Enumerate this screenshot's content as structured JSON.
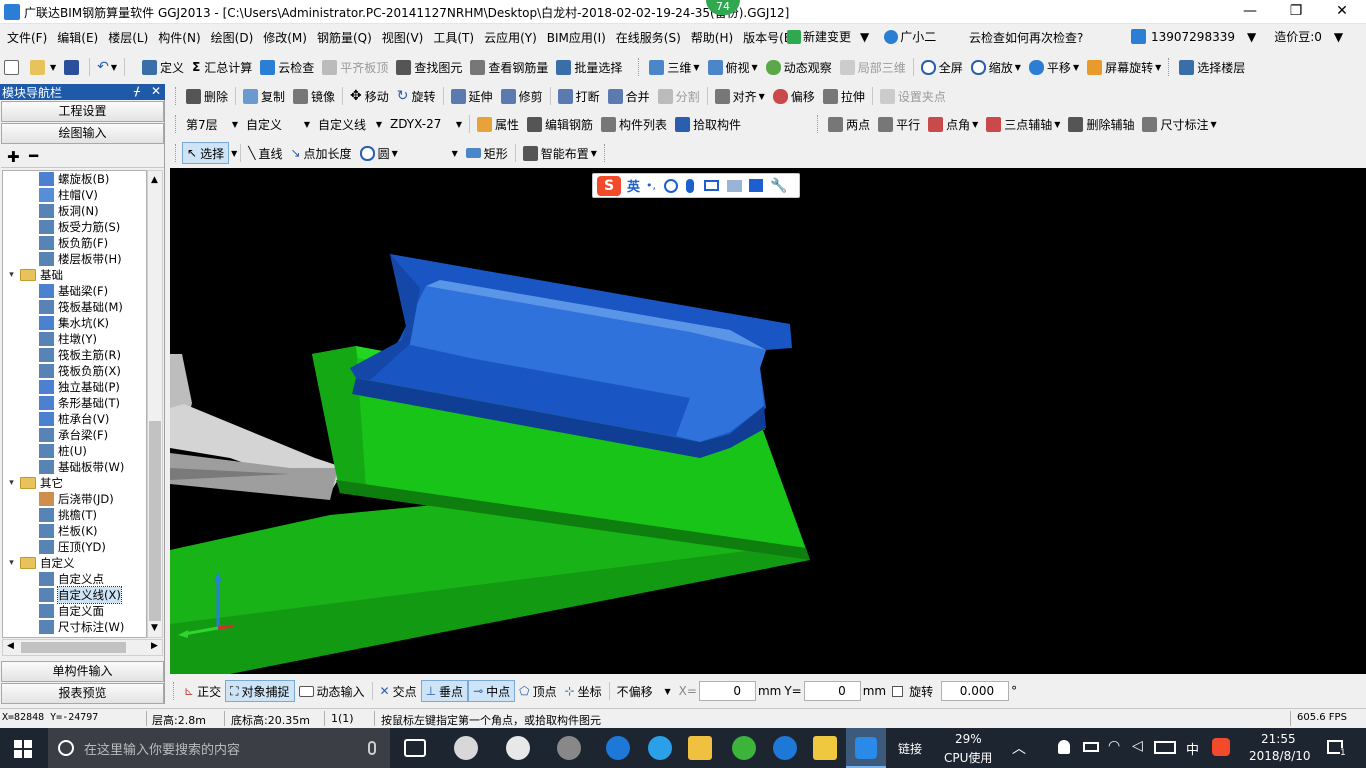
{
  "window": {
    "title": "广联达BIM钢筋算量软件 GGJ2013 - [C:\\Users\\Administrator.PC-20141127NRHM\\Desktop\\白龙村-2018-02-02-19-24-35(备份).GGJ12]",
    "badge": "74",
    "minimize": "—",
    "restore": "❐",
    "close": "✕"
  },
  "menu": {
    "items": [
      "文件(F)",
      "编辑(E)",
      "楼层(L)",
      "构件(N)",
      "绘图(D)",
      "修改(M)",
      "钢筋量(Q)",
      "视图(V)",
      "工具(T)",
      "云应用(Y)",
      "BIM应用(I)",
      "在线服务(S)",
      "帮助(H)",
      "版本号(B)"
    ],
    "new_change": "新建变更",
    "assistant": "广小二",
    "cloud_check_question": "云检查如何再次检查?",
    "phone": "13907298339",
    "cost_beans": "造价豆:0"
  },
  "toolbar1": {
    "define": "定义",
    "sum": "汇总计算",
    "cloud_check": "云检查",
    "flush_slab": "平齐板顶",
    "find_element": "查找图元",
    "view_rebar": "查看钢筋量",
    "batch_select": "批量选择",
    "three_d": "三维",
    "top_view": "俯视",
    "dynamic_view": "动态观察",
    "local_3d": "局部三维",
    "full_screen": "全屏",
    "zoom": "缩放",
    "pan": "平移",
    "rotate_screen": "屏幕旋转",
    "select_floor": "选择楼层"
  },
  "toolbar2": {
    "delete": "删除",
    "copy": "复制",
    "mirror": "镜像",
    "move": "移动",
    "rotate": "旋转",
    "extend": "延伸",
    "trim": "修剪",
    "break": "打断",
    "merge": "合并",
    "split": "分割",
    "align": "对齐",
    "offset": "偏移",
    "stretch": "拉伸",
    "set_grip": "设置夹点"
  },
  "toolbar3": {
    "floor": "第7层",
    "category": "自定义",
    "type": "自定义线",
    "element": "ZDYX-27",
    "properties": "属性",
    "edit_rebar": "编辑钢筋",
    "element_list": "构件列表",
    "pick_element": "拾取构件",
    "two_points": "两点",
    "parallel": "平行",
    "point_angle": "点角",
    "three_point_axis": "三点辅轴",
    "delete_axis": "删除辅轴",
    "dimension": "尺寸标注"
  },
  "toolbar4": {
    "select": "选择",
    "line": "直线",
    "point_length": "点加长度",
    "circle": "圆",
    "rect": "矩形",
    "smart_layout": "智能布置"
  },
  "ime": {
    "logo": "S",
    "lang": "英",
    "punct": "•,"
  },
  "nav": {
    "title": "模块导航栏",
    "pin": "ᚋ",
    "close": "✕",
    "engineering_settings": "工程设置",
    "drawing_input": "绘图输入",
    "single_input": "单构件输入",
    "report_preview": "报表预览",
    "tree": [
      {
        "kind": "item",
        "label": "螺旋板(B)",
        "icon_color": "#2d6ac8"
      },
      {
        "kind": "item",
        "label": "柱帽(V)",
        "icon_color": "#3a7ad0"
      },
      {
        "kind": "item",
        "label": "板洞(N)",
        "icon_color": "#3a6ea8"
      },
      {
        "kind": "item",
        "label": "板受力筋(S)",
        "icon_color": "#3a6ea8"
      },
      {
        "kind": "item",
        "label": "板负筋(F)",
        "icon_color": "#3a6ea8"
      },
      {
        "kind": "item",
        "label": "楼层板带(H)",
        "icon_color": "#3a6ea8"
      },
      {
        "kind": "folder",
        "label": "基础"
      },
      {
        "kind": "item",
        "label": "基础梁(F)",
        "icon_color": "#2d6ac8"
      },
      {
        "kind": "item",
        "label": "筏板基础(M)",
        "icon_color": "#3a6ea8"
      },
      {
        "kind": "item",
        "label": "集水坑(K)",
        "icon_color": "#2d6ac8"
      },
      {
        "kind": "item",
        "label": "柱墩(Y)",
        "icon_color": "#3a6ea8"
      },
      {
        "kind": "item",
        "label": "筏板主筋(R)",
        "icon_color": "#3a6ea8"
      },
      {
        "kind": "item",
        "label": "筏板负筋(X)",
        "icon_color": "#3a6ea8"
      },
      {
        "kind": "item",
        "label": "独立基础(P)",
        "icon_color": "#2d6ac8"
      },
      {
        "kind": "item",
        "label": "条形基础(T)",
        "icon_color": "#2d6ac8"
      },
      {
        "kind": "item",
        "label": "桩承台(V)",
        "icon_color": "#2d6ac8"
      },
      {
        "kind": "item",
        "label": "承台梁(F)",
        "icon_color": "#3a6ea8"
      },
      {
        "kind": "item",
        "label": "桩(U)",
        "icon_color": "#3a6ea8"
      },
      {
        "kind": "item",
        "label": "基础板带(W)",
        "icon_color": "#3a6ea8"
      },
      {
        "kind": "folder",
        "label": "其它"
      },
      {
        "kind": "item",
        "label": "后浇带(JD)",
        "icon_color": "#c87a2d"
      },
      {
        "kind": "item",
        "label": "挑檐(T)",
        "icon_color": "#3a6ea8"
      },
      {
        "kind": "item",
        "label": "栏板(K)",
        "icon_color": "#3a6ea8"
      },
      {
        "kind": "item",
        "label": "压顶(YD)",
        "icon_color": "#3a6ea8"
      },
      {
        "kind": "folder",
        "label": "自定义"
      },
      {
        "kind": "item",
        "label": "自定义点",
        "icon_color": "#3a6ea8"
      },
      {
        "kind": "item",
        "label": "自定义线(X)",
        "icon_color": "#3a6ea8",
        "selected": true
      },
      {
        "kind": "item",
        "label": "自定义面",
        "icon_color": "#3a6ea8"
      },
      {
        "kind": "item",
        "label": "尺寸标注(W)",
        "icon_color": "#3a6ea8"
      }
    ]
  },
  "snapbar": {
    "ortho": "正交",
    "object_snap": "对象捕捉",
    "dynamic_input": "动态输入",
    "intersection": "交点",
    "perpendicular": "垂点",
    "midpoint": "中点",
    "vertex": "顶点",
    "coordinate": "坐标",
    "offset_mode": "不偏移",
    "x_label": "X=",
    "x_value": "0",
    "y_label": "Y=",
    "y_value": "0",
    "unit": "mm",
    "rotate_label": "旋转",
    "rotate_value": "0.000",
    "degree": "°"
  },
  "status": {
    "coords": "X=82848 Y=-24797",
    "floor_height": "层高:2.8m",
    "base_height": "底标高:20.35m",
    "count": "1(1)",
    "hint": "按鼠标左键指定第一个角点，或拾取构件图元",
    "fps": "605.6 FPS"
  },
  "taskbar": {
    "search_placeholder": "在这里输入你要搜索的内容",
    "link": "链接",
    "cpu_percent": "29%",
    "cpu_label": "CPU使用",
    "ime": "中",
    "time": "21:55",
    "date": "2018/8/10",
    "notif_count": "1"
  },
  "colors": {
    "nav_title_bg": "#1e5aa8",
    "viewport_bg": "#000000",
    "slab_green": "#19c819",
    "gutter_blue": "#1d5fd0",
    "taskbar_bg": "#1c2530",
    "badge_green": "#2fa84f"
  }
}
